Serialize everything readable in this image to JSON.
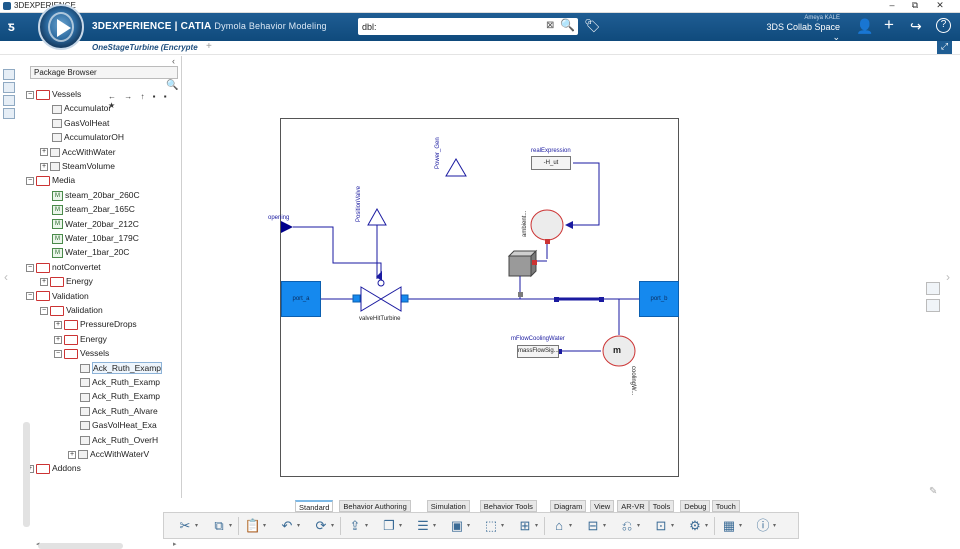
{
  "window": {
    "title": "3DEXPERIENCE",
    "minimize": "–",
    "maximize": "⧉",
    "close": "✕"
  },
  "header": {
    "brand_prefix": "3DEXPERIENCE | CATIA",
    "app_name": "Dymola Behavior Modeling",
    "search_value": "dbl:",
    "search_clear": "⊠",
    "search_icon": "🔍",
    "tag_icon": "🏷",
    "user_name": "Ameya KALE",
    "collab_space": "3DS Collab Space ⌄",
    "icons": {
      "add_user": "👤",
      "add": "+",
      "share": "↪",
      "help": "?"
    }
  },
  "tabs": {
    "document": "OneStageTurbine (Encrypte",
    "add": "+"
  },
  "package_browser": {
    "title": "Package Browser",
    "toolbar": "← → ↑ ▪ ▪ ★",
    "tree": [
      {
        "label": "Vessels",
        "kind": "fold",
        "expand": "−",
        "indent": 1
      },
      {
        "label": "Accumulator",
        "kind": "mdl",
        "indent": 2
      },
      {
        "label": "GasVolHeat",
        "kind": "mdl",
        "indent": 2
      },
      {
        "label": "AccumulatorOH",
        "kind": "mdl",
        "indent": 2
      },
      {
        "label": "AccWithWater",
        "kind": "mdl",
        "expand": "+",
        "indent": 2
      },
      {
        "label": "SteamVolume",
        "kind": "mdl",
        "expand": "+",
        "indent": 2
      },
      {
        "label": "Media",
        "kind": "fold",
        "expand": "−",
        "indent": 1
      },
      {
        "label": "steam_20bar_260C",
        "kind": "pkg",
        "indent": 2
      },
      {
        "label": "steam_2bar_165C",
        "kind": "pkg",
        "indent": 2
      },
      {
        "label": "Water_20bar_212C",
        "kind": "pkg",
        "indent": 2
      },
      {
        "label": "Water_10bar_179C",
        "kind": "pkg",
        "indent": 2
      },
      {
        "label": "Water_1bar_20C",
        "kind": "pkg",
        "indent": 2
      },
      {
        "label": "notConvertet",
        "kind": "fold",
        "expand": "−",
        "indent": 1
      },
      {
        "label": "Energy",
        "kind": "fold",
        "expand": "+",
        "indent": 2
      },
      {
        "label": "Validation",
        "kind": "fold",
        "expand": "−",
        "indent": 1
      },
      {
        "label": "Validation",
        "kind": "fold",
        "expand": "−",
        "indent": 2
      },
      {
        "label": "PressureDrops",
        "kind": "fold",
        "expand": "+",
        "indent": 3
      },
      {
        "label": "Energy",
        "kind": "fold",
        "expand": "+",
        "indent": 3
      },
      {
        "label": "Vessels",
        "kind": "fold",
        "expand": "−",
        "indent": 3
      },
      {
        "label": "Ack_Ruth_Examp",
        "kind": "mdl",
        "indent": 4,
        "selected": true
      },
      {
        "label": "Ack_Ruth_Examp",
        "kind": "mdl",
        "indent": 4
      },
      {
        "label": "Ack_Ruth_Examp",
        "kind": "mdl",
        "indent": 4
      },
      {
        "label": "Ack_Ruth_Alvare",
        "kind": "mdl",
        "indent": 4
      },
      {
        "label": "GasVolHeat_Exa",
        "kind": "mdl",
        "indent": 4
      },
      {
        "label": "Ack_Ruth_OverH",
        "kind": "mdl",
        "indent": 4
      },
      {
        "label": "AccWithWaterV",
        "kind": "mdl",
        "expand": "+",
        "indent": 4
      },
      {
        "label": "Addons",
        "kind": "fold",
        "expand": "+",
        "indent": 1
      }
    ]
  },
  "diagram": {
    "labels": {
      "power_gen": "Power_Gen",
      "real_expression": "realExpression",
      "h_ut": "-H_ut",
      "ambient": "ambient...",
      "position_valve": "PositionValve",
      "opening": "opening",
      "port_a": "port_a",
      "port_b": "port_b",
      "valve": "valveHitTurbine",
      "m_flow_cooling_water": "mFlowCoolingWater",
      "mass_flow_sig": "massFlowSig...",
      "cooling": "coolingW...",
      "cooling_icon": "m"
    }
  },
  "bottom_tabs": [
    "Standard",
    "Behavior Authoring",
    "Simulation",
    "Behavior Tools",
    "Diagram",
    "View",
    "AR-VR",
    "Tools",
    "Debug",
    "Touch"
  ],
  "active_tab": "Standard",
  "toolbar_icons": [
    {
      "name": "cut-icon",
      "glyph": "✂"
    },
    {
      "name": "copy-icon",
      "glyph": "⧉"
    },
    {
      "name": "paste-icon",
      "glyph": "📋"
    },
    {
      "name": "undo-icon",
      "glyph": "↶"
    },
    {
      "name": "update-icon",
      "glyph": "⟳"
    },
    {
      "name": "export-icon",
      "glyph": "⇪"
    },
    {
      "name": "duplicate-icon",
      "glyph": "❐"
    },
    {
      "name": "properties-icon",
      "glyph": "☰"
    },
    {
      "name": "component-icon",
      "glyph": "▣"
    },
    {
      "name": "select-icon",
      "glyph": "⬚"
    },
    {
      "name": "insert-icon",
      "glyph": "⊞"
    },
    {
      "name": "hierarchy-icon",
      "glyph": "⌂"
    },
    {
      "name": "structure-icon",
      "glyph": "⊟"
    },
    {
      "name": "measure-icon",
      "glyph": "⎌"
    },
    {
      "name": "inspect-icon",
      "glyph": "⊡"
    },
    {
      "name": "tool-icon",
      "glyph": "⚙"
    },
    {
      "name": "grid-icon",
      "glyph": "▦"
    },
    {
      "name": "info-icon",
      "glyph": "ⓘ"
    }
  ],
  "colors": {
    "header": "#1f5d93",
    "port": "#1589ee",
    "diagram_line": "#1a1aa0"
  }
}
